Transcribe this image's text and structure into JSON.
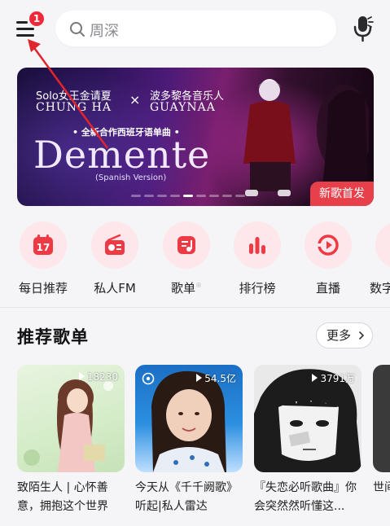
{
  "header": {
    "notification_count": "1",
    "search_placeholder": "周深"
  },
  "banner": {
    "artist_left_line1": "Solo女王金请夏",
    "artist_left_line2": "CHUNG HA",
    "separator": "×",
    "artist_right_line1": "波多黎各音乐人",
    "artist_right_line2": "GUAYNAA",
    "subtitle": "• 全新合作西班牙语单曲 •",
    "title": "Demente",
    "version": "(Spanish Version)",
    "tag": "新歌首发",
    "page_index": 5,
    "page_count": 9
  },
  "quick_nav": [
    {
      "label": "每日推荐",
      "icon": "calendar-icon",
      "day": "17"
    },
    {
      "label": "私人FM",
      "icon": "radio-icon"
    },
    {
      "label": "歌单",
      "icon": "playlist-icon",
      "mark": "®"
    },
    {
      "label": "排行榜",
      "icon": "chart-icon"
    },
    {
      "label": "直播",
      "icon": "live-icon"
    },
    {
      "label": "数字",
      "icon": "album-icon"
    }
  ],
  "section": {
    "title": "推荐歌单",
    "more_label": "更多"
  },
  "playlists": [
    {
      "title": "致陌生人 | 心怀善意，拥抱这个世界",
      "play_count": "18230"
    },
    {
      "title": "今天从《千千阙歌》听起|私人雷达",
      "play_count": "54.5亿"
    },
    {
      "title": "『失恋必听歌曲』你会突然然听懂这...",
      "play_count": "3791万"
    },
    {
      "title": "世间"
    }
  ],
  "colors": {
    "accent": "#e8404a",
    "icon_bg": "#fde7ea",
    "background": "#f5f4f6"
  }
}
